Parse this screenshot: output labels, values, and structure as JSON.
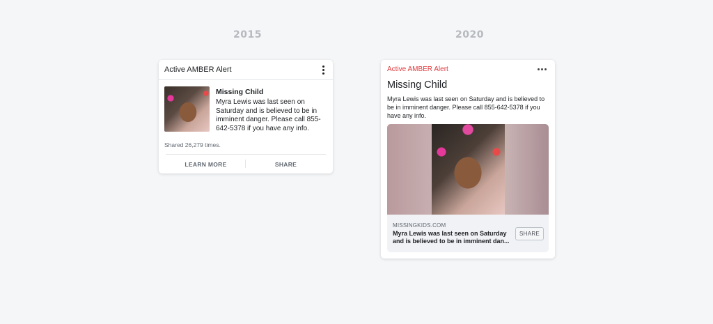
{
  "labels": {
    "year_old": "2015",
    "year_new": "2020"
  },
  "old_card": {
    "header": "Active AMBER Alert",
    "title": "Missing Child",
    "description": "Myra Lewis was last seen on Saturday and is believed to be in imminent danger. Please call 855-642-5378 if you have any info.",
    "shared": "Shared 26,279 times.",
    "learn_more": "LEARN MORE",
    "share": "SHARE",
    "menu_icon": "kebab-vertical-icon"
  },
  "new_card": {
    "header": "Active AMBER Alert",
    "title": "Missing Child",
    "description": "Myra Lewis was last seen on Saturday and is believed to be in imminent danger. Please call 855-642-5378 if you have any info.",
    "link_domain": "MISSINGKIDS.COM",
    "link_text": "Myra Lewis was last seen on Saturday and is believed to be in imminent dan...",
    "share": "SHARE",
    "menu_icon": "more-horizontal-icon",
    "header_color": "#e0393e"
  }
}
